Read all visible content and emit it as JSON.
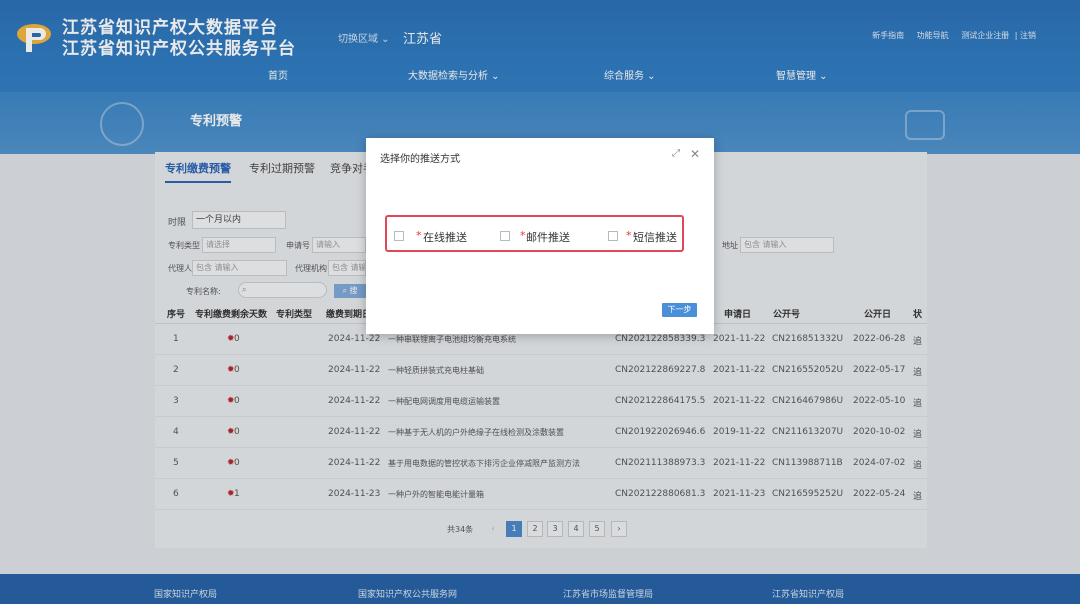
{
  "header": {
    "title_line1": "江苏省知识产权大数据平台",
    "title_line2": "江苏省知识产权公共服务平台",
    "region_switch": "切换区域 ⌄",
    "region_name": "江苏省",
    "top_links": [
      "新手指南",
      "功能导航",
      "测试企业注册",
      "| 注销"
    ]
  },
  "nav": [
    "首页",
    "大数据检索与分析 ⌄",
    "综合服务 ⌄",
    "智慧管理 ⌄"
  ],
  "banner": {
    "title": "专利预警"
  },
  "tabs": [
    "专利缴费预警",
    "专利过期预警",
    "竞争对手"
  ],
  "filters": {
    "time_label": "时限",
    "time_value": "一个月以内",
    "patent_type_label": "专利类型",
    "patent_type_value": "请选择",
    "app_no_label": "申请号",
    "app_no_value": "请输入",
    "address_label": "地址",
    "address_value": "包含  请输入",
    "agent_label": "代理人",
    "agent_value": "包含  请输入",
    "agency_label": "代理机构",
    "agency_value": "包含  请输",
    "patent_name_label": "专利名称:",
    "search_btn": "搜"
  },
  "table": {
    "headers": [
      "序号",
      "专利缴费剩余天数",
      "专利类型",
      "缴费到期日",
      "申请日",
      "公开号",
      "公开日",
      "状"
    ],
    "rows": [
      {
        "idx": "1",
        "days": "0",
        "due": "2024-11-22",
        "name": "一种串联锂离子电池组均衡充电系统",
        "app_no": "CN202122858339.3",
        "app_date": "2021-11-22",
        "pub_no": "CN216851332U",
        "pub_date": "2022-06-28",
        "status": "追"
      },
      {
        "idx": "2",
        "days": "0",
        "due": "2024-11-22",
        "name": "一种轻质拼装式充电柱基础",
        "app_no": "CN202122869227.8",
        "app_date": "2021-11-22",
        "pub_no": "CN216552052U",
        "pub_date": "2022-05-17",
        "status": "追"
      },
      {
        "idx": "3",
        "days": "0",
        "due": "2024-11-22",
        "name": "一种配电网调度用电缆运输装置",
        "app_no": "CN202122864175.5",
        "app_date": "2021-11-22",
        "pub_no": "CN216467986U",
        "pub_date": "2022-05-10",
        "status": "追"
      },
      {
        "idx": "4",
        "days": "0",
        "due": "2024-11-22",
        "name": "一种基于无人机的户外绝缘子在线检测及涂敷装置",
        "app_no": "CN201922026946.6",
        "app_date": "2019-11-22",
        "pub_no": "CN211613207U",
        "pub_date": "2020-10-02",
        "status": "追"
      },
      {
        "idx": "5",
        "days": "0",
        "due": "2024-11-22",
        "name": "基于用电数据的管控状态下排污企业停减限产监测方法",
        "app_no": "CN202111388973.3",
        "app_date": "2021-11-22",
        "pub_no": "CN113988711B",
        "pub_date": "2024-07-02",
        "status": "追"
      },
      {
        "idx": "6",
        "days": "1",
        "due": "2024-11-23",
        "name": "一种户外的智能电能计量箱",
        "app_no": "CN202122880681.3",
        "app_date": "2021-11-23",
        "pub_no": "CN216595252U",
        "pub_date": "2022-05-24",
        "status": "追"
      }
    ]
  },
  "pager": {
    "total": "共34条",
    "prev": "‹",
    "pages": [
      "1",
      "2",
      "3",
      "4",
      "5"
    ],
    "next": "›",
    "current": "1"
  },
  "footer": [
    "国家知识产权局",
    "国家知识产权公共服务网",
    "江苏省市场监督管理局",
    "江苏省知识产权局"
  ],
  "modal": {
    "title": "选择你的推送方式",
    "expand_icon": "⤢",
    "close_icon": "✕",
    "options": [
      {
        "required": "*",
        "label": "在线推送",
        "checked": false
      },
      {
        "required": "*",
        "label": "邮件推送",
        "checked": false
      },
      {
        "required": "*",
        "label": "短信推送",
        "checked": false
      }
    ],
    "next_button": "下一步",
    "highlight_color": "#e0485a"
  },
  "colors": {
    "brand_blue": "#2a6fb6",
    "accent": "#4a90d9",
    "alert_red": "#b22222"
  }
}
